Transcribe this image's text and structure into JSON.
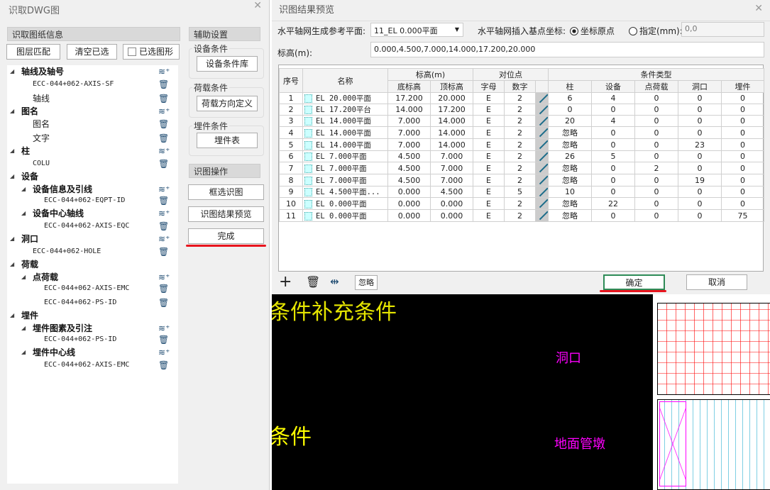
{
  "left": {
    "title": "识取DWG图",
    "section_info": "识取图纸信息",
    "btn_layer_match": "图层匹配",
    "btn_clear": "清空已选",
    "chk_selected": "已选图形",
    "tree": [
      {
        "label": "轴线及轴号",
        "level": 0,
        "bold": true,
        "arrow": true,
        "icon": "layers-add-icon"
      },
      {
        "label": "ECC-044+062-AXIS-SF",
        "level": 1,
        "mono": true,
        "icon": "trash-icon"
      },
      {
        "label": "轴线",
        "level": 1,
        "icon": "trash-icon"
      },
      {
        "label": "图名",
        "level": 0,
        "bold": true,
        "arrow": true,
        "icon": "layers-add-icon"
      },
      {
        "label": "图名",
        "level": 1,
        "icon": "trash-icon"
      },
      {
        "label": "文字",
        "level": 1,
        "icon": "trash-icon"
      },
      {
        "label": "柱",
        "level": 0,
        "bold": true,
        "arrow": true,
        "icon": "layers-add-icon"
      },
      {
        "label": "COLU",
        "level": 1,
        "mono": true,
        "icon": "trash-icon"
      },
      {
        "label": "设备",
        "level": 0,
        "bold": true,
        "arrow": true,
        "icon": ""
      },
      {
        "label": "设备信息及引线",
        "level": 1,
        "bold": true,
        "arrow": true,
        "icon": "layers-add-icon"
      },
      {
        "label": "ECC-044+062-EQPT-ID",
        "level": 2,
        "mono": true,
        "icon": "trash-icon"
      },
      {
        "label": "设备中心轴线",
        "level": 1,
        "bold": true,
        "arrow": true,
        "icon": "layers-add-icon"
      },
      {
        "label": "ECC-044+062-AXIS-EQC",
        "level": 2,
        "mono": true,
        "icon": "trash-icon"
      },
      {
        "label": "洞口",
        "level": 0,
        "bold": true,
        "arrow": true,
        "icon": "layers-add-icon"
      },
      {
        "label": "ECC-044+062-HOLE",
        "level": 1,
        "mono": true,
        "icon": "trash-icon"
      },
      {
        "label": "荷载",
        "level": 0,
        "bold": true,
        "arrow": true,
        "icon": ""
      },
      {
        "label": "点荷载",
        "level": 1,
        "bold": true,
        "arrow": true,
        "icon": "layers-add-icon"
      },
      {
        "label": "ECC-044+062-AXIS-EMC",
        "level": 2,
        "mono": true,
        "icon": "trash-icon"
      },
      {
        "label": "ECC-044+062-PS-ID",
        "level": 2,
        "mono": true,
        "icon": "trash-icon"
      },
      {
        "label": "埋件",
        "level": 0,
        "bold": true,
        "arrow": true,
        "icon": ""
      },
      {
        "label": "埋件图素及引注",
        "level": 1,
        "bold": true,
        "arrow": true,
        "icon": "layers-add-icon"
      },
      {
        "label": "ECC-044+062-PS-ID",
        "level": 2,
        "mono": true,
        "icon": "trash-icon"
      },
      {
        "label": "埋件中心线",
        "level": 1,
        "bold": true,
        "arrow": true,
        "icon": "layers-add-icon"
      },
      {
        "label": "ECC-044+062-AXIS-EMC",
        "level": 2,
        "mono": true,
        "icon": "trash-icon"
      }
    ],
    "aux": {
      "title": "辅助设置",
      "equip_group": "设备条件",
      "equip_btn": "设备条件库",
      "load_group": "荷载条件",
      "load_btn": "荷载方向定义",
      "embed_group": "埋件条件",
      "embed_btn": "埋件表",
      "ops_title": "识图操作",
      "btn_box": "框选识图",
      "btn_preview": "识图结果预览",
      "btn_done": "完成"
    }
  },
  "right": {
    "title": "识图结果预览",
    "ref_label": "水平轴网生成参考平面:",
    "ref_value": "11_EL 0.000平面",
    "base_label": "水平轴网插入基点坐标:",
    "radio_origin": "坐标原点",
    "radio_specify": "指定(mm):",
    "specify_value": "0,0",
    "elev_label": "标高(m):",
    "elev_value": "0.000,4.500,7.000,14.000,17.200,20.000",
    "headers": {
      "no": "序号",
      "name": "名称",
      "elev": "标高(m)",
      "bottom": "底标高",
      "top": "顶标高",
      "align": "对位点",
      "letter": "字母",
      "digit": "数字",
      "cond": "条件类型",
      "col": "柱",
      "equip": "设备",
      "pload": "点荷载",
      "hole": "洞口",
      "embed": "埋件"
    },
    "rows": [
      [
        "1",
        "EL 20.000平面",
        "17.200",
        "20.000",
        "E",
        "2",
        "6",
        "4",
        "0",
        "0",
        "0"
      ],
      [
        "2",
        "EL 17.200平台",
        "14.000",
        "17.200",
        "E",
        "2",
        "0",
        "0",
        "0",
        "0",
        "0"
      ],
      [
        "3",
        "EL 14.000平面",
        "7.000",
        "14.000",
        "E",
        "2",
        "20",
        "4",
        "0",
        "0",
        "0"
      ],
      [
        "4",
        "EL 14.000平面",
        "7.000",
        "14.000",
        "E",
        "2",
        "忽略",
        "0",
        "0",
        "0",
        "0"
      ],
      [
        "5",
        "EL 14.000平面",
        "7.000",
        "14.000",
        "E",
        "2",
        "忽略",
        "0",
        "0",
        "23",
        "0"
      ],
      [
        "6",
        "EL 7.000平面",
        "4.500",
        "7.000",
        "E",
        "2",
        "26",
        "5",
        "0",
        "0",
        "0"
      ],
      [
        "7",
        "EL 7.000平面",
        "4.500",
        "7.000",
        "E",
        "2",
        "忽略",
        "0",
        "2",
        "0",
        "0"
      ],
      [
        "8",
        "EL 7.000平面",
        "4.500",
        "7.000",
        "E",
        "2",
        "忽略",
        "0",
        "0",
        "19",
        "0"
      ],
      [
        "9",
        "EL 4.500平面...",
        "0.000",
        "4.500",
        "E",
        "5",
        "10",
        "0",
        "0",
        "0",
        "0"
      ],
      [
        "10",
        "EL 0.000平面",
        "0.000",
        "0.000",
        "E",
        "2",
        "忽略",
        "22",
        "0",
        "0",
        "0"
      ],
      [
        "11",
        "EL 0.000平面",
        "0.000",
        "0.000",
        "E",
        "2",
        "忽略",
        "0",
        "0",
        "0",
        "75"
      ]
    ],
    "btn_ignore": "忽略",
    "btn_ok": "确定",
    "btn_cancel": "取消"
  },
  "canvas": {
    "text1": "条件补充条件",
    "text2": "条件",
    "text3": "洞口",
    "text4": "地面管墩"
  },
  "colors": {
    "underline": "#e8141e",
    "ok_border": "#2e8b57",
    "cad_yellow": "#ffff00",
    "cad_magenta": "#ff00ff"
  }
}
